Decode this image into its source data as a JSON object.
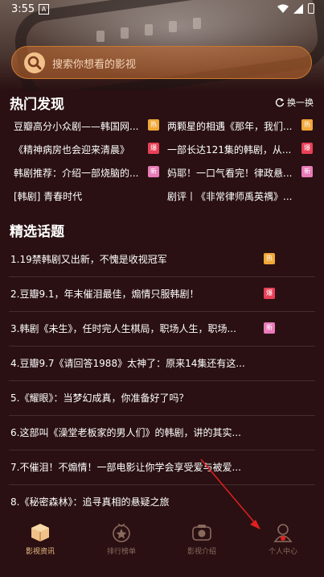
{
  "status_bar": {
    "time": "3:55",
    "a_label": "A"
  },
  "search": {
    "placeholder": "搜索你想看的影视"
  },
  "hot": {
    "title": "热门发现",
    "refresh_label": "换一换",
    "items": [
      {
        "text": "豆瓣高分小众剧——韩国网...",
        "badge": "热",
        "badge_type": "hot"
      },
      {
        "text": "两颗星的相遇《那年，我们...",
        "badge": "热",
        "badge_type": "hot"
      },
      {
        "text": "《精神病房也会迎来清晨》",
        "badge": "爆",
        "badge_type": "burst"
      },
      {
        "text": "一部长达121集的韩剧，从...",
        "badge": "爆",
        "badge_type": "burst"
      },
      {
        "text": "韩剧推荐：介绍一部烧脑的...",
        "badge": "新",
        "badge_type": "new"
      },
      {
        "text": "妈耶！一口气看完！律政悬...",
        "badge": "新",
        "badge_type": "new"
      },
      {
        "text": "[韩剧] 青春时代",
        "badge": "",
        "badge_type": ""
      },
      {
        "text": "剧评丨《非常律师禹英禑》...",
        "badge": "",
        "badge_type": ""
      }
    ]
  },
  "topics": {
    "title": "精选话题",
    "items": [
      {
        "text": "1.19禁韩剧又出新，不愧是收视冠军",
        "badge": "热",
        "badge_type": "hot"
      },
      {
        "text": "2.豆瓣9.1，年末催泪最佳，煽情只服韩剧！",
        "badge": "爆",
        "badge_type": "burst"
      },
      {
        "text": "3.韩剧《未生》，任时完人生棋局，职场人生，职场...",
        "badge": "新",
        "badge_type": "new"
      },
      {
        "text": "4.豆瓣9.7《请回答1988》太神了：原来14集还有这...",
        "badge": "",
        "badge_type": ""
      },
      {
        "text": "5.《耀眼》：当梦幻成真，你准备好了吗？",
        "badge": "",
        "badge_type": ""
      },
      {
        "text": "6.这部叫《澡堂老板家的男人们》的韩剧，讲的其实...",
        "badge": "",
        "badge_type": ""
      },
      {
        "text": "7.不催泪！不煽情！一部电影让你学会享受爱与被爱...",
        "badge": "",
        "badge_type": ""
      },
      {
        "text": "8.《秘密森林》：追寻真相的悬疑之旅",
        "badge": "",
        "badge_type": ""
      }
    ]
  },
  "nav": {
    "items": [
      {
        "label": "影视资讯",
        "active": true,
        "icon": "box-icon"
      },
      {
        "label": "排行榜单",
        "active": false,
        "icon": "ranking-icon"
      },
      {
        "label": "影视介绍",
        "active": false,
        "icon": "camera-icon"
      },
      {
        "label": "个人中心",
        "active": false,
        "icon": "person-icon"
      }
    ]
  },
  "colors": {
    "background": "#2a1012",
    "accent": "#c9782e",
    "badge_hot": "#f0a838",
    "badge_burst": "#e84057",
    "badge_new": "#e97ab8",
    "nav_active": "#f0c28a",
    "nav_inactive": "#8b6a5e",
    "annotation_arrow": "#e02020"
  }
}
